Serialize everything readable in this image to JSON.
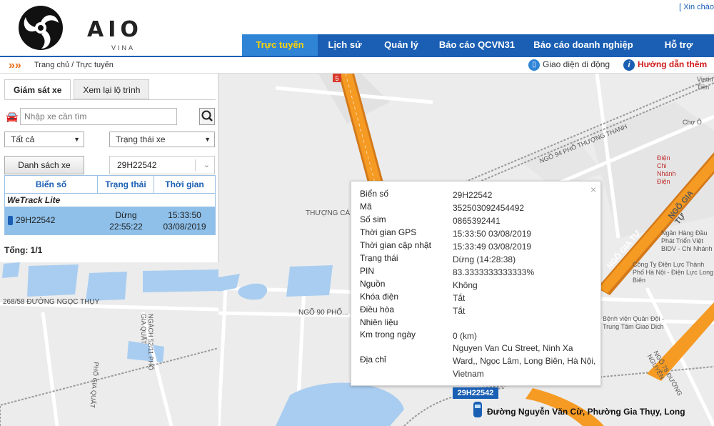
{
  "header": {
    "logo_text": "AIO",
    "logo_sub": "VINA",
    "login_link": "[ Xin chào"
  },
  "nav": {
    "items": [
      {
        "label": "Trực tuyến",
        "active": true
      },
      {
        "label": "Lịch sử",
        "active": false
      },
      {
        "label": "Quản lý",
        "active": false
      },
      {
        "label": "Báo cáo QCVN31",
        "active": false
      },
      {
        "label": "Báo cáo doanh nghiệp",
        "active": false
      },
      {
        "label": "Hỗ trợ",
        "active": false
      }
    ]
  },
  "breadcrumb": "Trang chủ / Trực tuyến",
  "toolbar": {
    "mobile_label": "Giao diện di động",
    "guide_label": "Hướng dẫn thêm"
  },
  "sidebar": {
    "tabs": [
      "Giám sát xe",
      "Xem lại lộ trình"
    ],
    "search": {
      "placeholder": "Nhập xe cần tìm"
    },
    "filter_all": "Tất cả",
    "filter_status": "Trạng thái xe",
    "list_button": "Danh sách xe",
    "vehicle_combo": "29H22542",
    "table": {
      "headers": [
        "Biển số",
        "Trạng thái",
        "Thời gian"
      ],
      "group": "WeTrack Lite",
      "rows": [
        {
          "plate": "29H22542",
          "status": "Dừng",
          "status_time": "22:55:22",
          "time": "15:33:50",
          "date": "03/08/2019"
        }
      ]
    },
    "total": "Tổng: 1/1"
  },
  "popup": {
    "close": "×",
    "fields": [
      {
        "label": "Biển số",
        "value": "29H22542"
      },
      {
        "label": "Mã",
        "value": "352503092454492"
      },
      {
        "label": "Số sim",
        "value": "0865392441"
      },
      {
        "label": "Thời gian GPS",
        "value": "15:33:50 03/08/2019"
      },
      {
        "label": "Thời gian cập nhật",
        "value": "15:33:49 03/08/2019"
      },
      {
        "label": "Trạng thái",
        "value": "Dừng (14:28:38)"
      },
      {
        "label": "PIN",
        "value": "83.3333333333333%"
      },
      {
        "label": "Nguồn",
        "value": "Không"
      },
      {
        "label": "Khóa điện",
        "value": "Tắt"
      },
      {
        "label": "Điều hòa",
        "value": "Tắt"
      },
      {
        "label": "Nhiên liệu",
        "value": ""
      },
      {
        "label": "Km trong ngày",
        "value": "0 (km)"
      },
      {
        "label": "Địa chỉ",
        "value": "Nguyen Van Cu Street, Ninh Xa Ward,, Ngọc Lâm, Long Biên, Hà Nội, Vietnam"
      }
    ]
  },
  "map": {
    "marker_label": "29H22542",
    "street_label": "Đường Nguyễn Văn Cừ, Phường Gia Thụy, Long",
    "labels": [
      "THƯỢNG CÁ",
      "NGÕ 94 PHỐ THƯỢNG THANH",
      "NGÕ GIA TỰ",
      "NGÕ GIA TỰ",
      "Ngân Hàng Đầu Phát Triển Việt BIDV - Chi Nhánh",
      "Công Ty Điện Lực Thành Phố Hà Nội - Điện Lực Long Biên",
      "Bệnh viện Quân Đội - Trung Tâm Giao Dịch",
      "Chợ Ô",
      "Điện Chi Nhánh Điện",
      "Vietin Tiền",
      "268/58 ĐƯỜNG NGỌC THỤY",
      "NGÕ 90 PHỐ...",
      "NGÁCH 52/11 PHỐ GIA QUẤT",
      "PHỐ GIA QUẤT",
      "NGÕ 78 ĐƯỜNG NGUYỄN",
      "5"
    ],
    "colors": {
      "highway": "#f59a23",
      "highway_border": "#d3791a",
      "background": "#ececec",
      "water": "#a9cdf0",
      "rail": "#9a9a9a"
    }
  }
}
